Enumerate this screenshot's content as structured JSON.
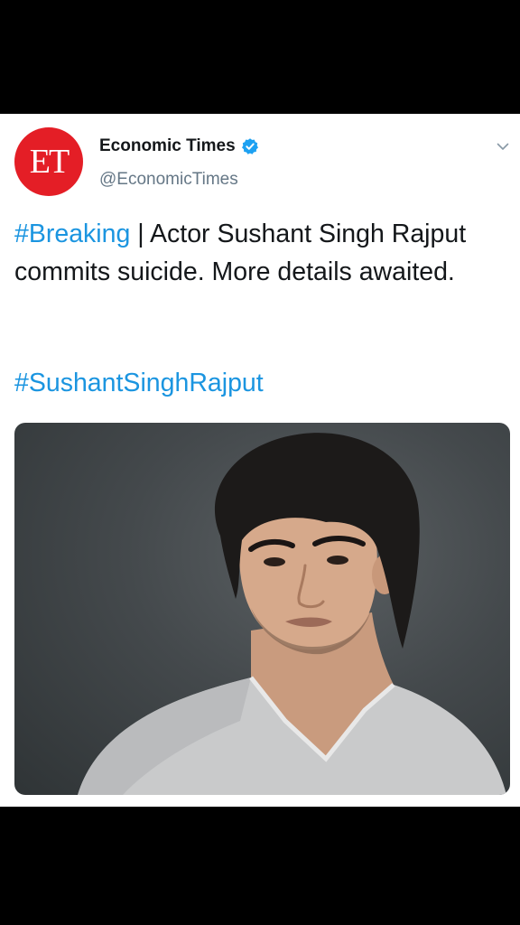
{
  "tweet": {
    "display_name": "Economic Times",
    "handle": "@EconomicTimes",
    "avatar_text": "ET",
    "verified": true,
    "text": {
      "hashtag_1": "#Breaking",
      "body": " | Actor Sushant Singh Rajput commits suicide. More details awaited.",
      "hashtag_2": "#SushantSinghRajput"
    },
    "media": {
      "type": "photo"
    }
  },
  "icons": {
    "verified": "verified-badge-icon",
    "caret": "chevron-down-icon"
  },
  "colors": {
    "hashtag": "#1b95e0",
    "avatar_bg": "#e41e26",
    "verified": "#1da1f2",
    "secondary_text": "#657786",
    "frame": "#000000"
  }
}
